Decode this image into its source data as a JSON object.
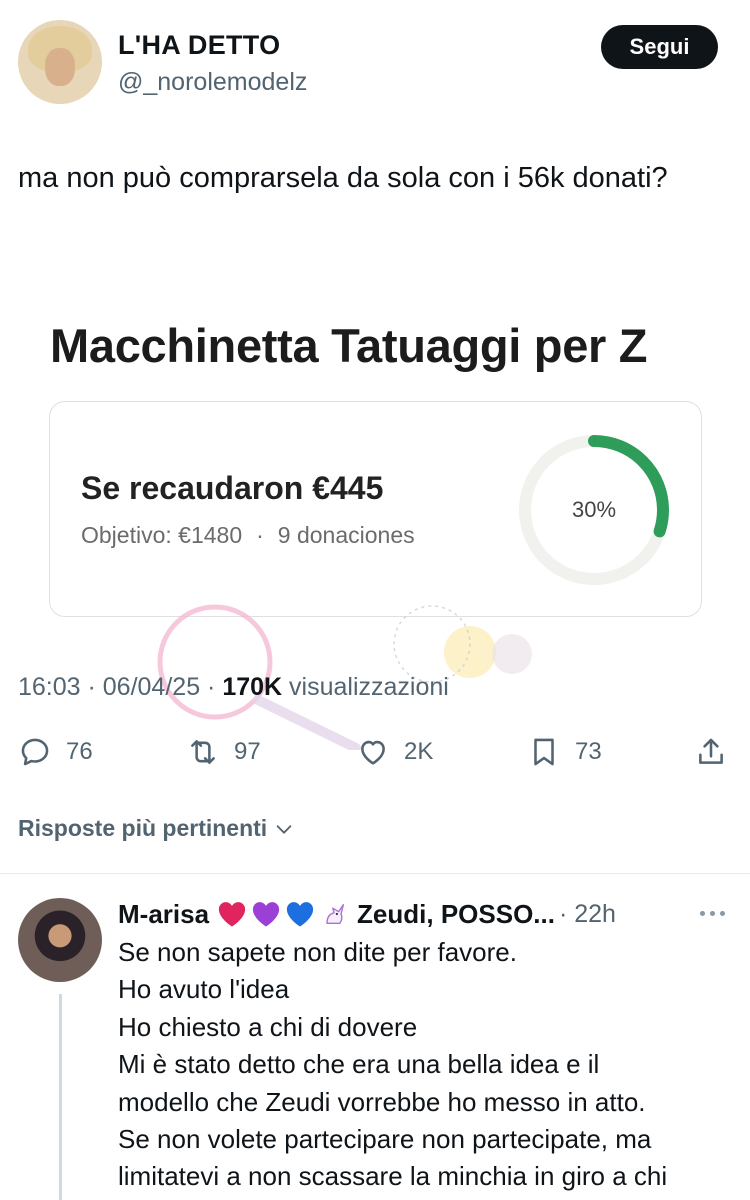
{
  "tweet": {
    "display_name": "L'HA DETTO",
    "handle": "@_norolemodelz",
    "follow_label": "Segui",
    "text": "ma non può comprarsela da sola con i 56k donati?",
    "timestamp": "16:03 · 06/04/25 ·",
    "views_count": "170K",
    "views_label": "visualizzazioni"
  },
  "campaign": {
    "title": "Macchinetta Tatuaggi per Z",
    "raised": "Se recaudaron €445",
    "goal": "Objetivo: €1480",
    "separator": "·",
    "donations": "9 donaciones",
    "progress_label": "30%",
    "progress_fraction": 0.3,
    "ring_color": "#2e9d5a",
    "track_color": "#f1f1ee"
  },
  "actions": {
    "replies": "76",
    "reposts": "97",
    "likes": "2K",
    "bookmarks": "73"
  },
  "replies_filter": "Risposte più pertinenti",
  "reply": {
    "name": "M-arisa",
    "name_suffix": "Zeudi, POSSO...",
    "time": "· 22h",
    "lines": [
      "Se non sapete non dite per favore.",
      "Ho avuto l'idea",
      "Ho chiesto a chi di dovere",
      "Mi è stato detto che era una bella idea e il",
      "modello che Zeudi vorrebbe ho messo in atto.",
      "Se non volete partecipare non partecipate, ma",
      "limitatevi a non scassare la minchia in giro a chi"
    ]
  },
  "colors": {
    "text": "#0f1419",
    "secondary": "#536471",
    "heart_red": "#e0245e",
    "heart_purple": "#9b3fd6",
    "heart_blue": "#1d6fe0"
  }
}
